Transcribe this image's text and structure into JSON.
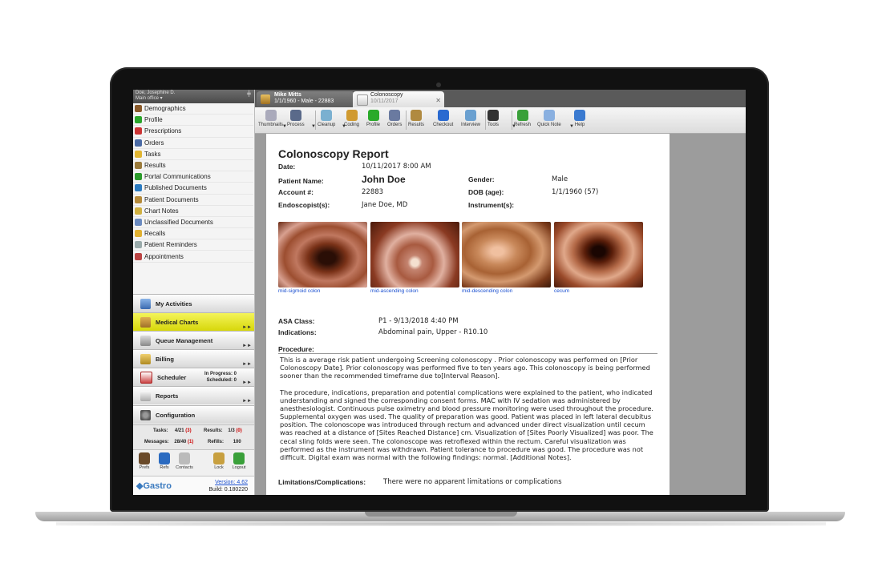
{
  "sidebar": {
    "user_name": "Doe, Josephine D.",
    "office": "Main office",
    "nav_items": [
      {
        "label": "Demographics",
        "icon": "person-icon",
        "color": "#8a5a2a"
      },
      {
        "label": "Profile",
        "icon": "plus-icon",
        "color": "#2aa52a"
      },
      {
        "label": "Prescriptions",
        "icon": "pill-icon",
        "color": "#c33"
      },
      {
        "label": "Orders",
        "icon": "doctor-icon",
        "color": "#4a6aa5"
      },
      {
        "label": "Tasks",
        "icon": "folder-icon",
        "color": "#e1b530"
      },
      {
        "label": "Results",
        "icon": "results-icon",
        "color": "#9a7a3a"
      },
      {
        "label": "Portal Communications",
        "icon": "portal-icon",
        "color": "#2a9a2a"
      },
      {
        "label": "Published Documents",
        "icon": "globe-icon",
        "color": "#2a7ac0"
      },
      {
        "label": "Patient Documents",
        "icon": "documents-icon",
        "color": "#b58a3a"
      },
      {
        "label": "Chart Notes",
        "icon": "note-icon",
        "color": "#d0b040"
      },
      {
        "label": "Unclassified Documents",
        "icon": "document-icon",
        "color": "#6a8ac0"
      },
      {
        "label": "Recalls",
        "icon": "recall-icon",
        "color": "#e0b030"
      },
      {
        "label": "Patient Reminders",
        "icon": "reminder-icon",
        "color": "#9aa"
      },
      {
        "label": "Appointments",
        "icon": "calendar-icon",
        "color": "#b44"
      }
    ],
    "modules": {
      "my_activities": "My Activities",
      "medical_charts": "Medical Charts",
      "queue_management": "Queue Management",
      "billing": "Billing",
      "scheduler": "Scheduler",
      "scheduler_in_progress": "In Progress: 0",
      "scheduler_scheduled": "Scheduled: 0",
      "reports": "Reports",
      "configuration": "Configuration"
    },
    "stats": {
      "tasks_label": "Tasks:",
      "tasks_value": "4/21",
      "tasks_red": "(3)",
      "results_label": "Results:",
      "results_value": "1/3",
      "results_red": "(0)",
      "messages_label": "Messages:",
      "messages_value": "28/40",
      "messages_red": "(1)",
      "refills_label": "Refills:",
      "refills_value": "100"
    },
    "bottom_tools": [
      {
        "label": "Prefs",
        "icon": "user-prefs-icon"
      },
      {
        "label": "Refs",
        "icon": "globe-icon"
      },
      {
        "label": "Contacts",
        "icon": "contacts-icon"
      },
      {
        "label": "Lock",
        "icon": "lock-icon"
      },
      {
        "label": "Logout",
        "icon": "power-icon"
      }
    ],
    "brand": "Gastro",
    "version": "Version: 4.62",
    "build": "Build: 0.180220"
  },
  "tabs": [
    {
      "title": "Mike Mitts",
      "subtitle": "1/1/1960 - Male - 22883",
      "icon": "patient-icon"
    },
    {
      "title": "Colonoscopy",
      "subtitle": "10/11/2017",
      "icon": "edit-document-icon"
    }
  ],
  "toolbar": {
    "buttons": [
      "Thumbnails",
      "Process",
      "Cleanup",
      "Coding",
      "Profile",
      "Orders",
      "Results",
      "Checkout",
      "Interview",
      "Tools",
      "Refresh",
      "Quick Note",
      "Help"
    ]
  },
  "report": {
    "title": "Colonoscopy Report",
    "date_label": "Date:",
    "date_value": "10/11/2017 8:00 AM",
    "patient_label": "Patient Name:",
    "patient_value": "John Doe",
    "gender_label": "Gender:",
    "gender_value": "Male",
    "account_label": "Account #:",
    "account_value": "22883",
    "dob_label": "DOB (age):",
    "dob_value": "1/1/1960 (57)",
    "endoscopist_label": "Endoscopist(s):",
    "endoscopist_value": "Jane Doe, MD",
    "instrument_label": "Instrument(s):",
    "images": [
      {
        "caption": "mid-sigmoid colon"
      },
      {
        "caption": "mid-ascending colon"
      },
      {
        "caption": "mid-descending colon"
      },
      {
        "caption": "cecum"
      }
    ],
    "asa_label": "ASA Class:",
    "asa_value": "P1 - 9/13/2018 4:40 PM",
    "indications_label": "Indications:",
    "indications_value": "Abdominal pain, Upper - R10.10",
    "procedure_label": "Procedure:",
    "procedure_p1": "This is a average risk patient undergoing Screening colonoscopy . Prior colonoscopy was performed on [Prior Colonoscopy Date]. Prior colonoscopy was performed five to ten years ago.  This colonoscopy is being performed sooner than the recommended timeframe due to[Interval Reason].",
    "procedure_p2": "The procedure, indications, preparation and potential complications were explained to the patient, who indicated understanding and signed the corresponding consent forms. MAC with IV sedation was administered by anesthesiologist. Continuous pulse oximetry and blood pressure monitoring were used throughout the procedure. Supplemental oxygen was used. The quality of preparation was good. Patient was placed in left lateral decubitus position. The colonoscope was introduced through rectum and advanced under direct visualization until cecum was reached at a distance of [Sites Reached Distance] cm. Visualization of [Sites Poorly Visualized] was poor. The cecal sling folds were seen. The colonoscope was retroflexed within the rectum. Careful visualization was performed as the instrument was withdrawn. Patient tolerance to procedure was good. The procedure was not difficult. Digital exam was normal with the following findings: normal. [Additional Notes].",
    "limitations_label": "Limitations/Complications:",
    "limitations_value": "There were no apparent limitations or complications"
  }
}
